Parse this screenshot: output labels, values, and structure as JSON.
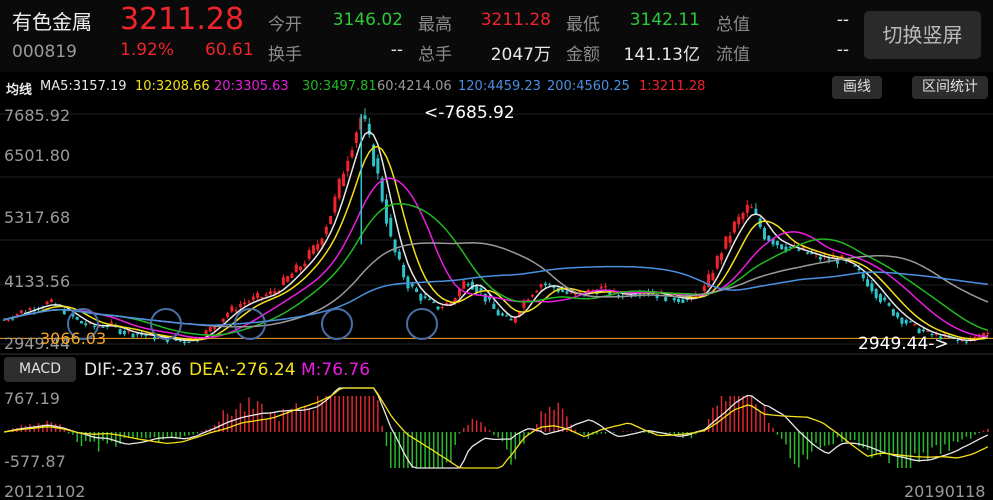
{
  "header": {
    "name": "有色金属",
    "code": "000819",
    "price": "3211.28",
    "change_pct": "1.92%",
    "change": "60.61",
    "labels": {
      "open": "今开",
      "high": "最高",
      "low": "最低",
      "total_value": "总值",
      "turnover": "换手",
      "volume": "总手",
      "amount": "金额",
      "float_value": "流值"
    },
    "values": {
      "open": "3146.02",
      "high": "3211.28",
      "low": "3142.11",
      "total_value": "--",
      "turnover": "--",
      "volume": "2047万",
      "amount": "141.13亿",
      "float_value": "--"
    },
    "orient_button": "切换竖屏"
  },
  "ma_bar": {
    "label": "均线",
    "items": [
      {
        "text": "MA5:3157.19",
        "color": "#e8e8e8"
      },
      {
        "text": "10:3208.66",
        "color": "#f5e11a"
      },
      {
        "text": "20:3305.63",
        "color": "#e81ee0"
      },
      {
        "text": "30:3497.81",
        "color": "#22b822"
      },
      {
        "text": "60:4214.06",
        "color": "#9a9a9a"
      },
      {
        "text": "120:4459.23",
        "color": "#4a90e2"
      },
      {
        "text": "200:4560.25",
        "color": "#4a90e2"
      },
      {
        "text": "1:3211.28",
        "color": "#f0242c"
      }
    ],
    "draw_button": "画线",
    "range_button": "区间统计"
  },
  "macd": {
    "button": "MACD",
    "dif": "DIF:-237.86",
    "dea": "DEA:-276.24",
    "m": "M:76.76"
  },
  "chart_data": [
    {
      "type": "candlestick",
      "title": "",
      "y_ticks": [
        "7685.92",
        "6501.80",
        "5317.68",
        "4133.56",
        "2949.44"
      ],
      "ylim": [
        2949.44,
        7685.92
      ],
      "annotations": {
        "max_label": "<-7685.92",
        "min_label": "2949.44->",
        "ref_line_label": "3066.03"
      },
      "x_start": "20121102",
      "x_end": "20190118",
      "close_approx": [
        3450,
        3600,
        3700,
        3800,
        3650,
        3400,
        3300,
        3350,
        3200,
        3150,
        3100,
        3050,
        3000,
        3066,
        3300,
        3600,
        3800,
        3900,
        4000,
        4300,
        4600,
        5000,
        5700,
        6800,
        7685,
        6500,
        5000,
        4200,
        3900,
        3700,
        3800,
        4300,
        4000,
        3600,
        3400,
        3900,
        4200,
        4100,
        3950,
        4000,
        4100,
        3950,
        4000,
        4050,
        3950,
        3900,
        3850,
        4100,
        4800,
        5400,
        5800,
        5200,
        5000,
        4900,
        4800,
        4700,
        4700,
        4500,
        4200,
        3800,
        3500,
        3300,
        3150,
        3100,
        3000,
        3050,
        3211
      ],
      "ma_series": [
        {
          "name": "MA5",
          "color": "#e8e8e8"
        },
        {
          "name": "10",
          "color": "#f5e11a"
        },
        {
          "name": "20",
          "color": "#e81ee0"
        },
        {
          "name": "30",
          "color": "#22b822"
        },
        {
          "name": "60",
          "color": "#9a9a9a"
        },
        {
          "name": "120",
          "color": "#4a90e2"
        }
      ]
    },
    {
      "type": "bar",
      "title": "",
      "y_ticks": [
        "767.19",
        "-577.87"
      ],
      "ylim": [
        -577.87,
        767.19
      ],
      "x_start": "20121102",
      "x_end": "20190118"
    }
  ]
}
